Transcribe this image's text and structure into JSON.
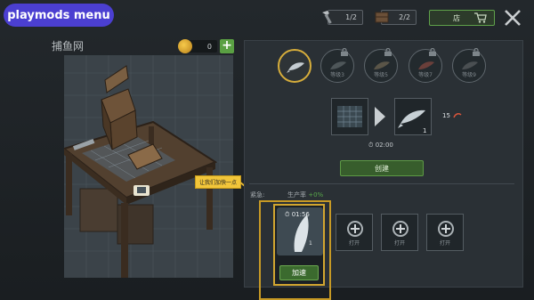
{
  "mod_menu": {
    "label": "playmods menu"
  },
  "topbar": {
    "hammer_count": "1/2",
    "crate_count": "2/2",
    "shop_label": "店"
  },
  "workshop": {
    "title": "捕鱼网",
    "coins": "0",
    "tooltip": "让我们加快一点"
  },
  "tiers": [
    {
      "label": "",
      "locked": false,
      "selected": true
    },
    {
      "label": "等级3",
      "locked": true
    },
    {
      "label": "等级5",
      "locked": true
    },
    {
      "label": "等级7",
      "locked": true
    },
    {
      "label": "等级9",
      "locked": true
    }
  ],
  "recipe": {
    "output_qty": "1",
    "extra_qty": "15",
    "time": "02:00",
    "create_label": "创建"
  },
  "production": {
    "materials_label": "紧急:",
    "rate_label": "生产率",
    "rate_value": "+0%"
  },
  "active_slot": {
    "timer": "01:56",
    "count": "1",
    "speed_label": "加速"
  },
  "empty_slots": [
    {
      "label": "打开"
    },
    {
      "label": "打开"
    },
    {
      "label": "打开"
    }
  ],
  "colors": {
    "accent_gold": "#d2a630",
    "accent_green": "#5d9a45",
    "mod_purple": "#4b3fd1"
  }
}
